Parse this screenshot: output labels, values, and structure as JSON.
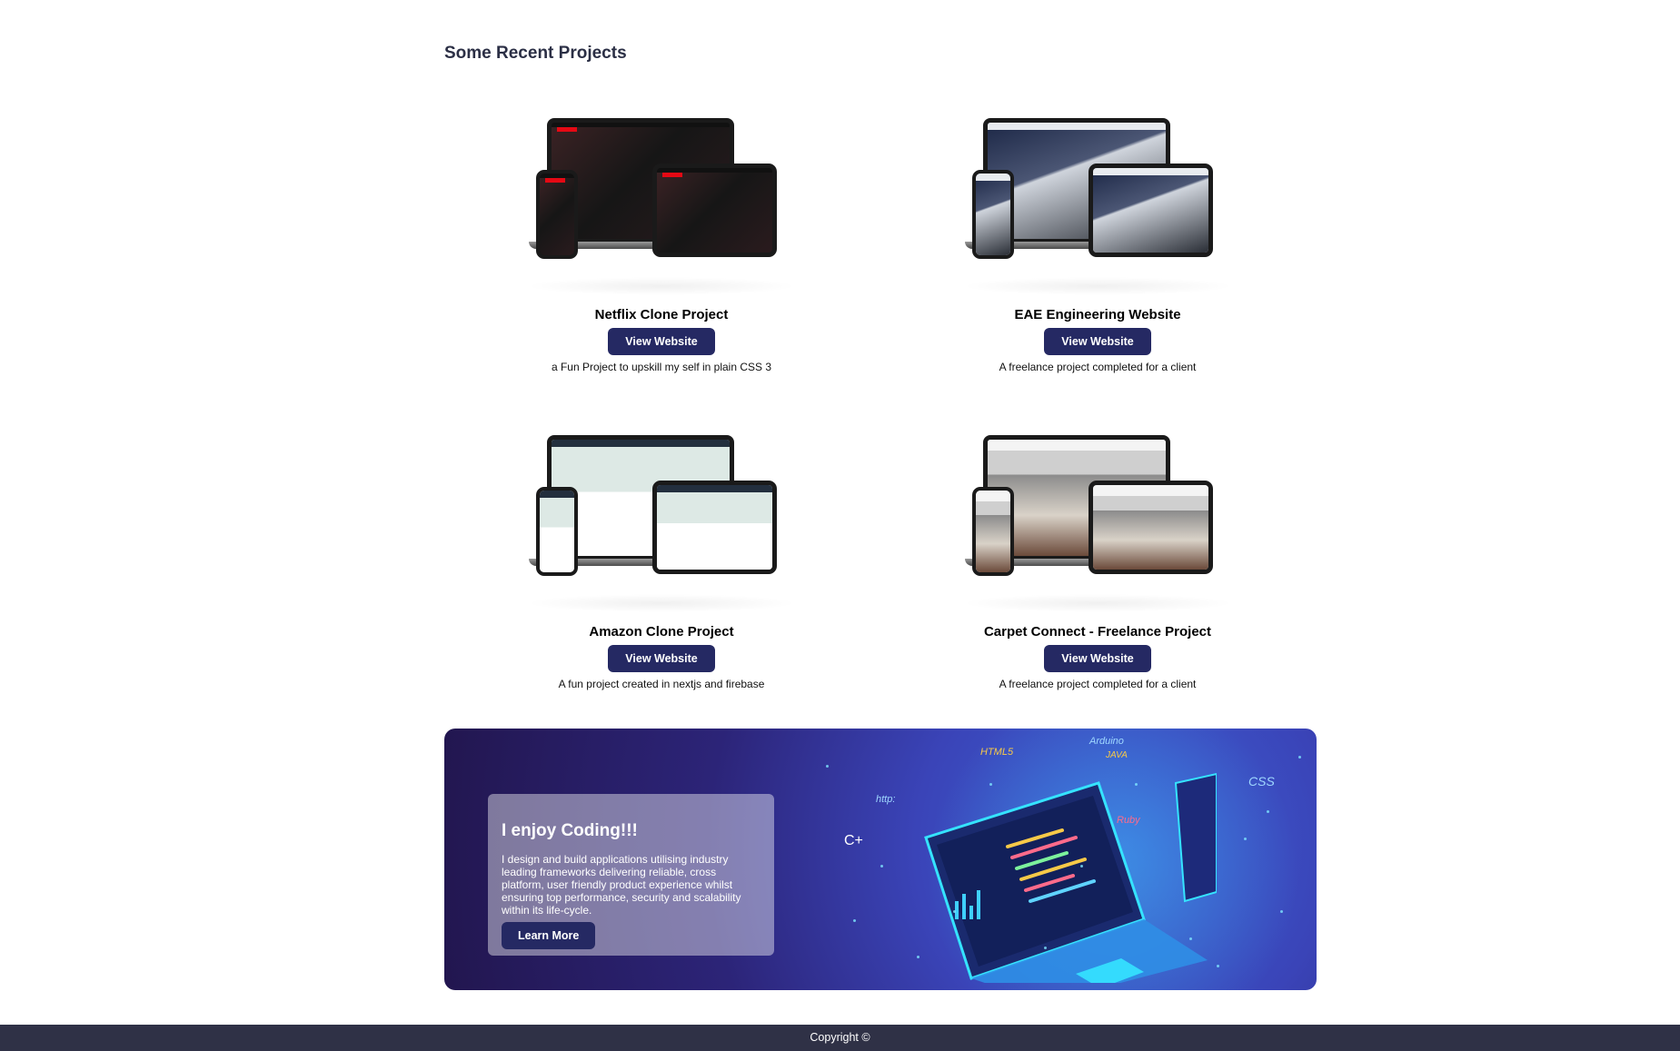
{
  "section": {
    "title": "Some Recent Projects"
  },
  "projects": [
    {
      "title": "Netflix Clone Project",
      "button": "View Website",
      "description": "a Fun Project to upskill my self in plain CSS 3"
    },
    {
      "title": "EAE Engineering Website",
      "button": "View Website",
      "description": "A freelance project completed for a client"
    },
    {
      "title": "Amazon Clone Project",
      "button": "View Website",
      "description": "A fun project created in nextjs and firebase"
    },
    {
      "title": "Carpet Connect - Freelance Project",
      "button": "View Website",
      "description": "A freelance project completed for a client"
    }
  ],
  "banner": {
    "heading": "I enjoy Coding!!!",
    "text": "I design and build applications utilising industry leading frameworks delivering reliable, cross platform, user friendly product experience whilst ensuring top performance, security and scalability within its life-cycle.",
    "button": "Learn More",
    "art_labels": [
      "HTML5",
      "http:",
      "C+",
      "Arduino",
      "JAVA",
      "Ruby",
      "CSS"
    ]
  },
  "footer": {
    "text": "Copyright ©"
  },
  "colors": {
    "button": "#252963",
    "footer": "#2f3146",
    "title": "#2b2f45"
  }
}
